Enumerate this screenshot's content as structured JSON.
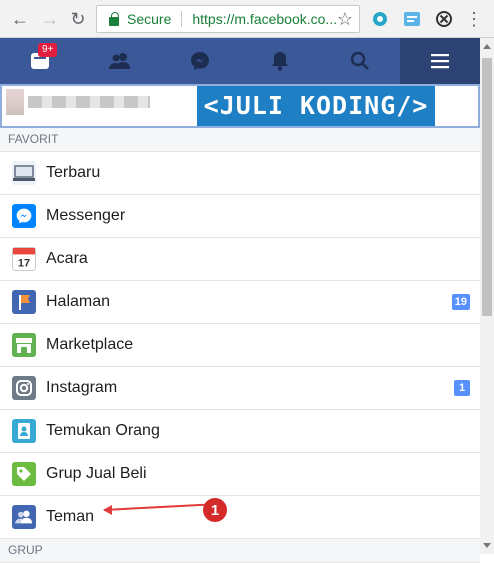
{
  "browser": {
    "secure_label": "Secure",
    "url": "https://m.facebook.co..."
  },
  "fb_bar": {
    "notification_count": "9+"
  },
  "banner": {
    "text": "<JULI KODING/>"
  },
  "sections": {
    "favorit": "FAVORIT",
    "grup": "GRUP"
  },
  "menu": [
    {
      "label": "Terbaru"
    },
    {
      "label": "Messenger"
    },
    {
      "label": "Acara"
    },
    {
      "label": "Halaman",
      "badge": "19"
    },
    {
      "label": "Marketplace"
    },
    {
      "label": "Instagram",
      "badge": "1"
    },
    {
      "label": "Temukan Orang"
    },
    {
      "label": "Grup Jual Beli"
    },
    {
      "label": "Teman"
    }
  ],
  "annotation": {
    "number": "1"
  },
  "colors": {
    "facebook_blue": "#3b5998",
    "badge_blue": "#5890ff",
    "secure_green": "#188038",
    "annotation_red": "#d42a2a",
    "banner_blue": "#1f7fc4"
  }
}
